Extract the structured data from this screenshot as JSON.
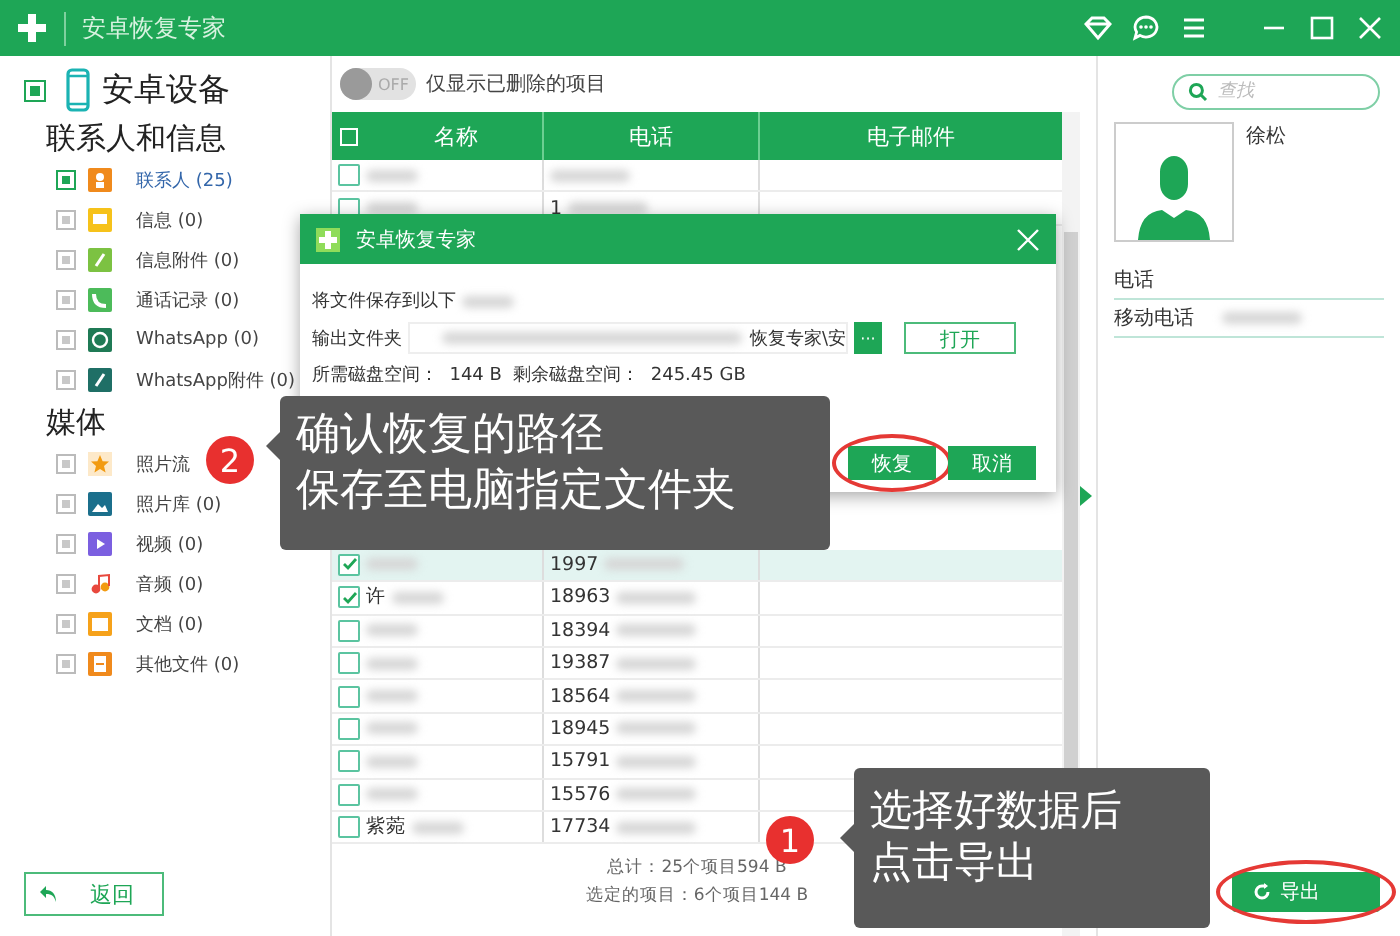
{
  "window": {
    "title": "安卓恢复专家"
  },
  "sidebar": {
    "device": {
      "label": "安卓设备",
      "checked": true
    },
    "sections": [
      {
        "title": "联系人和信息",
        "items": [
          {
            "label": "联系人 (25)",
            "kind": "contacts",
            "checked": true,
            "selected": true
          },
          {
            "label": "信息 (0)",
            "kind": "messages",
            "checked": false,
            "selected": false
          },
          {
            "label": "信息附件 (0)",
            "kind": "attachments",
            "checked": false,
            "selected": false
          },
          {
            "label": "通话记录 (0)",
            "kind": "calls",
            "checked": false,
            "selected": false
          },
          {
            "label": "WhatsApp (0)",
            "kind": "whatsapp",
            "checked": false,
            "selected": false
          },
          {
            "label": "WhatsApp附件 (0)",
            "kind": "whatsapp-files",
            "checked": false,
            "selected": false
          }
        ]
      },
      {
        "title": "媒体",
        "items": [
          {
            "label": "照片流",
            "kind": "photostream",
            "checked": false,
            "selected": false
          },
          {
            "label": "照片库 (0)",
            "kind": "photos",
            "checked": false,
            "selected": false
          },
          {
            "label": "视频 (0)",
            "kind": "video",
            "checked": false,
            "selected": false
          },
          {
            "label": "音频 (0)",
            "kind": "audio",
            "checked": false,
            "selected": false
          },
          {
            "label": "文档 (0)",
            "kind": "documents",
            "checked": false,
            "selected": false
          },
          {
            "label": "其他文件 (0)",
            "kind": "other",
            "checked": false,
            "selected": false
          }
        ]
      }
    ],
    "back_button": "返回"
  },
  "toggle": {
    "label": "OFF",
    "on": false,
    "text": "仅显示已删除的项目"
  },
  "search": {
    "placeholder": "查找"
  },
  "table": {
    "columns": [
      "名称",
      "电话",
      "电子邮件"
    ],
    "header_checked": false,
    "rows_top": [
      {
        "checked": false,
        "selected": false
      },
      {
        "checked": false,
        "selected": false,
        "phone": "1"
      }
    ],
    "rows": [
      {
        "checked": true,
        "selected": true,
        "phone": "1997"
      },
      {
        "checked": true,
        "selected": false,
        "name": "许",
        "phone": "18963"
      },
      {
        "checked": false,
        "selected": false,
        "phone": "18394"
      },
      {
        "checked": false,
        "selected": false,
        "phone": "19387"
      },
      {
        "checked": false,
        "selected": false,
        "phone": "18564"
      },
      {
        "checked": false,
        "selected": false,
        "phone": "18945"
      },
      {
        "checked": false,
        "selected": false,
        "phone": "15791"
      },
      {
        "checked": false,
        "selected": false,
        "phone": "15576"
      },
      {
        "checked": false,
        "selected": false,
        "name": "紫菀",
        "phone": "17734"
      }
    ]
  },
  "summary": {
    "total": "总计：25个项目594 B",
    "selected": "选定的项目：6个项目144 B"
  },
  "details": {
    "name": "徐松",
    "section": "电话",
    "fields": [
      {
        "label": "移动电话"
      }
    ]
  },
  "export_button": {
    "label": "导出",
    "circled": true
  },
  "dialog": {
    "title": "安卓恢复专家",
    "intro": "将文件保存到以下",
    "folder_label": "输出文件夹",
    "path": "恢复专家\\安",
    "browse": "···",
    "open": "打开",
    "space": "所需磁盘空间：  144 B  剩余磁盘空间：  245.45 GB",
    "buttons": [
      {
        "label": "恢复",
        "circled": true
      },
      {
        "label": "取消",
        "circled": false
      }
    ]
  },
  "callouts": [
    {
      "number": "1",
      "lines": [
        "选择好数据后",
        "点击导出"
      ]
    },
    {
      "number": "2",
      "lines": [
        "确认恢复的路径",
        "保存至电脑指定文件夹"
      ]
    }
  ]
}
